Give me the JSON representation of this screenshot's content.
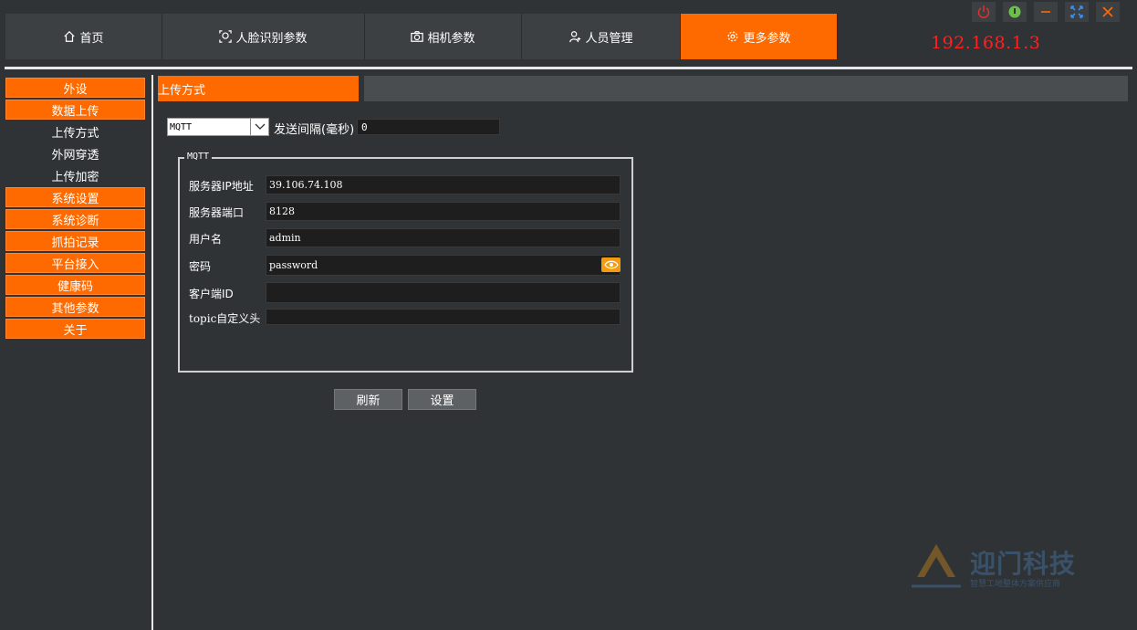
{
  "tabs": [
    {
      "label": "首页",
      "icon": "home-icon",
      "active": false
    },
    {
      "label": "人脸识别参数",
      "icon": "face-icon",
      "active": false
    },
    {
      "label": "相机参数",
      "icon": "camera-icon",
      "active": false
    },
    {
      "label": "人员管理",
      "icon": "person-icon",
      "active": false
    },
    {
      "label": "更多参数",
      "icon": "gear-icon",
      "active": true
    }
  ],
  "ip_address": "192.168.1.3",
  "window_controls": [
    "power-icon",
    "standby-icon",
    "minimize-icon",
    "fullscreen-icon",
    "close-icon"
  ],
  "sidebar": {
    "items": [
      {
        "label": "外设",
        "style": "orange"
      },
      {
        "label": "数据上传",
        "style": "orange"
      },
      {
        "label": "上传方式",
        "style": "sub"
      },
      {
        "label": "外网穿透",
        "style": "sub"
      },
      {
        "label": "上传加密",
        "style": "sub"
      },
      {
        "label": "系统设置",
        "style": "orange"
      },
      {
        "label": "系统诊断",
        "style": "orange"
      },
      {
        "label": "抓拍记录",
        "style": "orange"
      },
      {
        "label": "平台接入",
        "style": "orange"
      },
      {
        "label": "健康码",
        "style": "orange"
      },
      {
        "label": "其他参数",
        "style": "orange"
      },
      {
        "label": "关于",
        "style": "orange"
      }
    ]
  },
  "section_title": "上传方式",
  "method": {
    "value": "MQTT"
  },
  "interval": {
    "label": "发送间隔(毫秒)",
    "value": "0"
  },
  "mqtt": {
    "legend": "MQTT",
    "fields": {
      "server_ip": {
        "label": "服务器IP地址",
        "value": "39.106.74.108"
      },
      "server_port": {
        "label": "服务器端口",
        "value": "8128"
      },
      "username": {
        "label": "用户名",
        "value": "admin"
      },
      "password": {
        "label": "密码",
        "value": "password"
      },
      "client_id": {
        "label": "客户端ID",
        "value": ""
      },
      "topic": {
        "label": "topic自定义头",
        "value": ""
      }
    }
  },
  "buttons": {
    "refresh": "刷新",
    "set": "设置"
  },
  "watermark": {
    "title": "迎门科技",
    "subtitle": "智慧工地整体方案供应商"
  },
  "colors": {
    "accent": "#ff6a00",
    "background": "#2f3336",
    "ip": "#ff2020"
  }
}
